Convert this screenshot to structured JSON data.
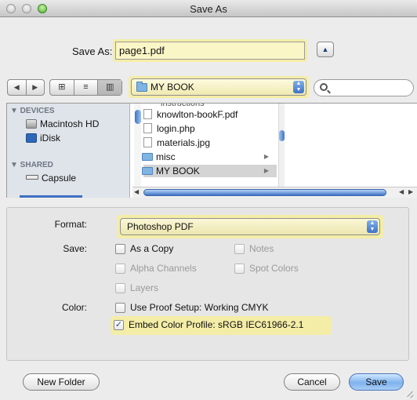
{
  "window": {
    "title": "Save As"
  },
  "save": {
    "label": "Save As:",
    "filename": "page1.pdf"
  },
  "toolbar": {
    "back_glyph": "◀",
    "forward_glyph": "▶",
    "view_icon_glyph": "⊞",
    "view_list_glyph": "≡",
    "view_column_glyph": "▥",
    "location": "MY BOOK",
    "search_value": ""
  },
  "sidebar": {
    "devices_header": "▼ DEVICES",
    "devices": [
      {
        "label": "Macintosh HD",
        "icon": "hard-drive-icon"
      },
      {
        "label": "iDisk",
        "icon": "idisk-icon"
      }
    ],
    "shared_header": "▼ SHARED",
    "shared": [
      {
        "label": "Capsule",
        "icon": "network-drive-icon"
      }
    ]
  },
  "files": {
    "cut_item": "instructions",
    "items": [
      {
        "name": "knowlton-bookF.pdf",
        "kind": "file"
      },
      {
        "name": "login.php",
        "kind": "file"
      },
      {
        "name": "materials.jpg",
        "kind": "file"
      },
      {
        "name": "misc",
        "kind": "folder"
      },
      {
        "name": "MY BOOK",
        "kind": "folder",
        "selected": true
      }
    ]
  },
  "options": {
    "format_label": "Format:",
    "format_value": "Photoshop PDF",
    "save_label": "Save:",
    "color_label": "Color:",
    "as_copy": {
      "label": "As a Copy",
      "checked": false,
      "enabled": true
    },
    "notes": {
      "label": "Notes",
      "checked": false,
      "enabled": false
    },
    "alpha_channels": {
      "label": "Alpha Channels",
      "checked": false,
      "enabled": false
    },
    "spot_colors": {
      "label": "Spot Colors",
      "checked": false,
      "enabled": false
    },
    "layers": {
      "label": "Layers",
      "checked": false,
      "enabled": false
    },
    "use_proof_setup": {
      "label": "Use Proof Setup:  Working CMYK",
      "checked": false,
      "enabled": true
    },
    "embed_color_profile": {
      "label": "Embed Color Profile:  sRGB IEC61966-2.1",
      "checked": true,
      "enabled": true
    }
  },
  "buttons": {
    "new_folder": "New Folder",
    "cancel": "Cancel",
    "save": "Save"
  },
  "colors": {
    "highlight": "#f4eda7",
    "accent": "#3f73c6",
    "default_button": "#7fb3ee"
  }
}
